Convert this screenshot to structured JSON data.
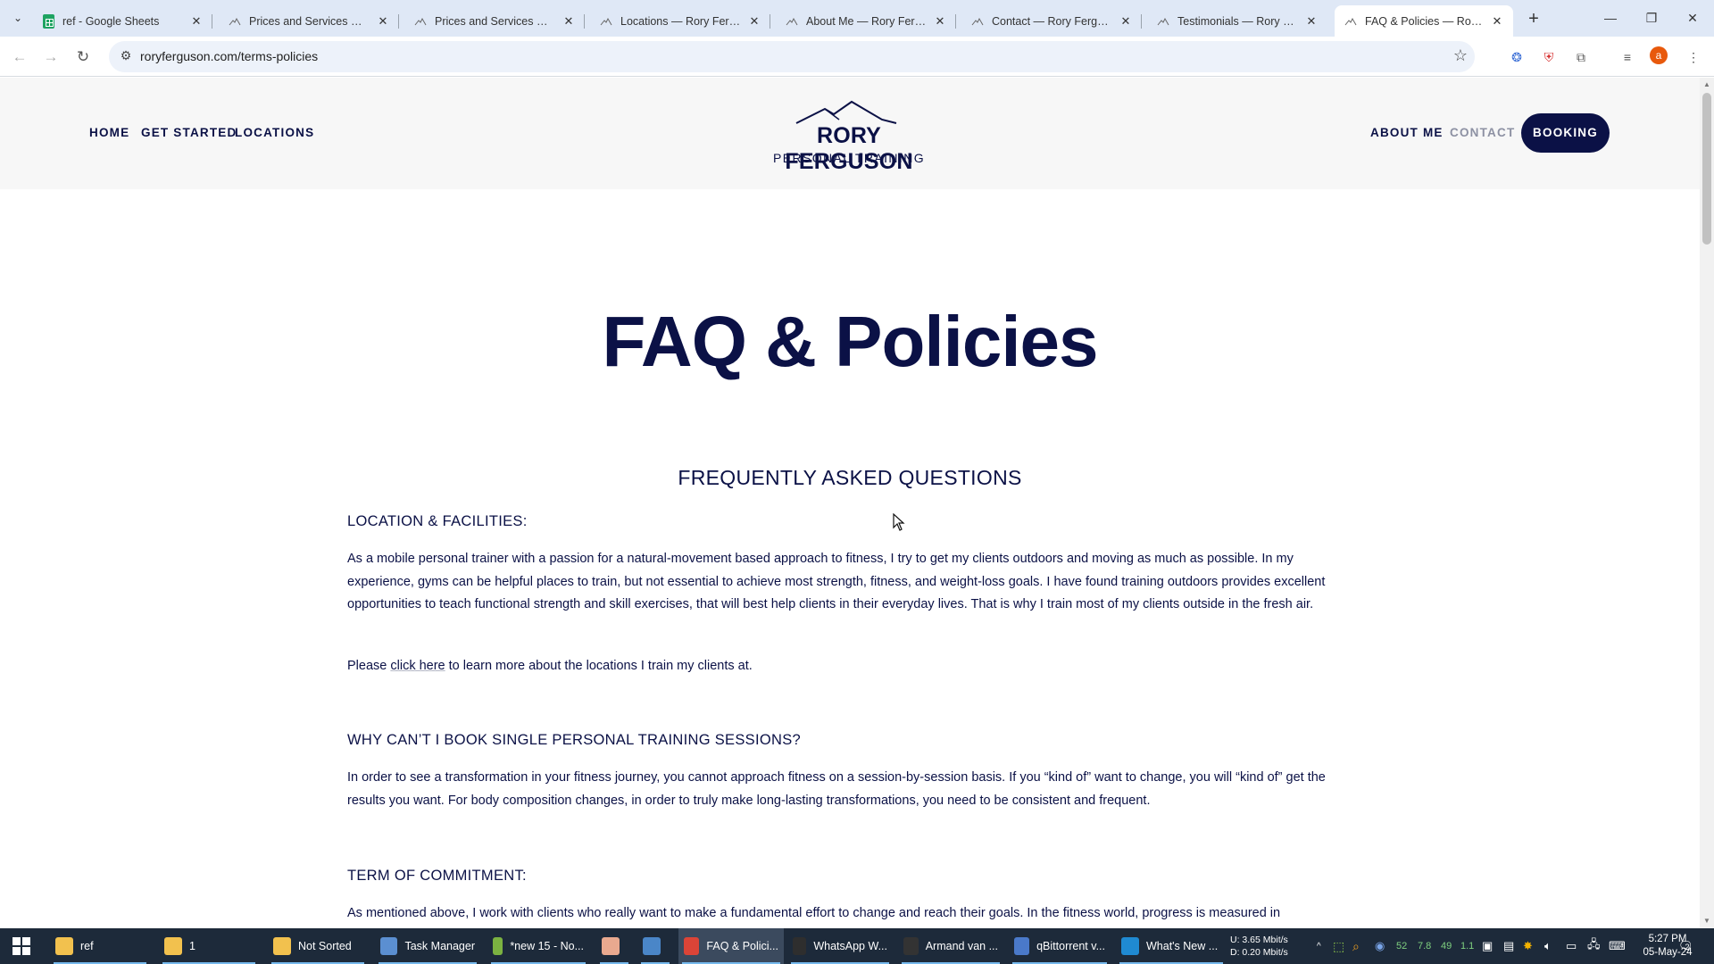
{
  "browser": {
    "tabs": [
      {
        "title": "ref - Google Sheets",
        "icon": "google-sheets-icon"
      },
      {
        "title": "Prices and Services — Ror",
        "icon": "site-favicon"
      },
      {
        "title": "Prices and Services — Ror",
        "icon": "site-favicon"
      },
      {
        "title": "Locations — Rory Ferguso",
        "icon": "site-favicon"
      },
      {
        "title": "About Me — Rory Fergus",
        "icon": "site-favicon"
      },
      {
        "title": "Contact — Rory Ferguson",
        "icon": "site-favicon"
      },
      {
        "title": "Testimonials — Rory Ferg",
        "icon": "site-favicon"
      },
      {
        "title": "FAQ & Policies — Rory Fe",
        "icon": "site-favicon",
        "active": true
      }
    ],
    "url": "roryferguson.com/terms-policies",
    "profile_initial": "a"
  },
  "site": {
    "nav_left": [
      "HOME",
      "GET STARTED",
      "LOCATIONS"
    ],
    "nav_right": [
      "ABOUT ME",
      "CONTACT"
    ],
    "booking_label": "BOOKING",
    "logo_name": "RORY FERGUSON",
    "logo_sub": "PERSONAL TRAINING",
    "accent": "#0b1146"
  },
  "page": {
    "title": "FAQ & Policies",
    "faq_heading": "FREQUENTLY ASKED QUESTIONS",
    "sections": [
      {
        "question": "LOCATION & FACILITIES:",
        "paragraph": "As a mobile personal trainer with a passion for a natural-movement based approach to fitness, I try to get my clients outdoors and moving as much as possible. In my experience, gyms can be helpful places to train, but not essential to achieve most strength, fitness, and weight-loss goals. I have found training outdoors provides excellent opportunities to teach functional strength and skill exercises, that will best help clients in their everyday lives. That is why I train most of my clients outside in the fresh air.",
        "link_prefix": "Please ",
        "link_text": "click here",
        "link_suffix": " to learn more about the locations I train my clients at."
      },
      {
        "question": "WHY CAN’T I BOOK SINGLE PERSONAL TRAINING SESSIONS?",
        "paragraph": "In order to see a transformation in your fitness journey, you cannot approach fitness on a session-by-session basis. If you “kind of” want to change, you will “kind of” get the results you want. For body composition changes, in order to truly make long-lasting transformations, you need to be consistent and frequent."
      },
      {
        "question": "TERM OF COMMITMENT:",
        "paragraph": "As mentioned above, I work with clients who really want to make a fundamental effort to change and reach their goals. In the fitness world, progress is measured in"
      }
    ]
  },
  "taskbar": {
    "items": [
      {
        "label": "ref",
        "icon": "folder-icon",
        "color": "#f2c14e"
      },
      {
        "label": "1",
        "icon": "folder-icon",
        "color": "#f2c14e"
      },
      {
        "label": "Not Sorted",
        "icon": "folder-icon",
        "color": "#f2c14e"
      },
      {
        "label": "Task Manager",
        "icon": "task-manager-icon",
        "color": "#5b8fd1"
      },
      {
        "label": "*new 15 - No...",
        "icon": "notepadpp-icon",
        "color": "#7bb241"
      },
      {
        "label": "",
        "icon": "app-icon",
        "color": "#e9a98f"
      },
      {
        "label": "",
        "icon": "notes-icon",
        "color": "#4a86c8"
      },
      {
        "label": "FAQ & Polici...",
        "icon": "chrome-icon",
        "color": "#db4437",
        "active": true
      },
      {
        "label": "WhatsApp W...",
        "icon": "whatsapp-icon",
        "color": "#2e2e2e"
      },
      {
        "label": "Armand van ...",
        "icon": "media-icon",
        "color": "#333"
      },
      {
        "label": "qBittorrent v...",
        "icon": "qbittorrent-icon",
        "color": "#4a79c9"
      },
      {
        "label": "What's New ...",
        "icon": "vscode-icon",
        "color": "#1f8ad2"
      }
    ],
    "net_up": "U:  3.65 Mbit/s",
    "net_down": "D:  0.20 Mbit/s",
    "tray_values": [
      "52",
      "7.8",
      "49",
      "1.1"
    ],
    "time": "5:27 PM",
    "date": "05-May-24",
    "notification_count": "2"
  }
}
